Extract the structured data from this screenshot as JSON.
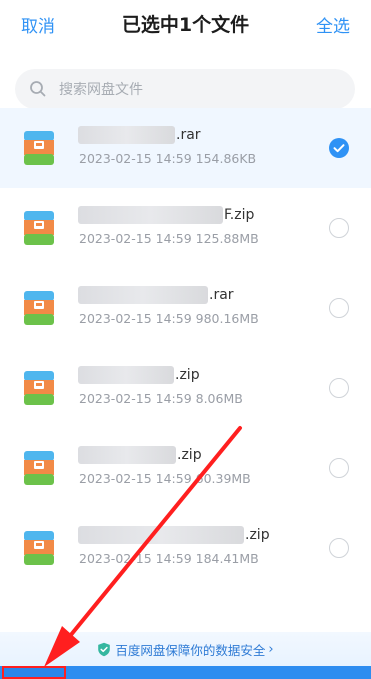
{
  "header": {
    "cancel_label": "取消",
    "title": "已选中1个文件",
    "select_all_label": "全选"
  },
  "search": {
    "placeholder": "搜索网盘文件"
  },
  "files": [
    {
      "ext": ".rar",
      "meta": "2023-02-15  14:59  154.86KB",
      "selected": true
    },
    {
      "ext": "F.zip",
      "meta": "2023-02-15  14:59  125.88MB",
      "selected": false
    },
    {
      "ext": ".rar",
      "meta": "2023-02-15  14:59  980.16MB",
      "selected": false
    },
    {
      "ext": ".zip",
      "meta": "2023-02-15  14:59  8.06MB",
      "selected": false
    },
    {
      "ext": ".zip",
      "meta": "2023-02-15  14:59  60.39MB",
      "selected": false
    },
    {
      "ext": ".zip",
      "meta": "2023-02-15  14:59  184.41MB",
      "selected": false
    }
  ],
  "notice": {
    "text": "百度网盘保障你的数据安全",
    "chevron": "›"
  },
  "icons": {
    "file": "archive-file-icon",
    "search": "search-icon",
    "check": "checkmark-icon",
    "shield": "shield-icon",
    "arrow": "red-annotation-arrow"
  },
  "colors": {
    "accent": "#2f92f5",
    "selected_row": "#f0f7ff",
    "annotation": "#ff1f1f"
  }
}
